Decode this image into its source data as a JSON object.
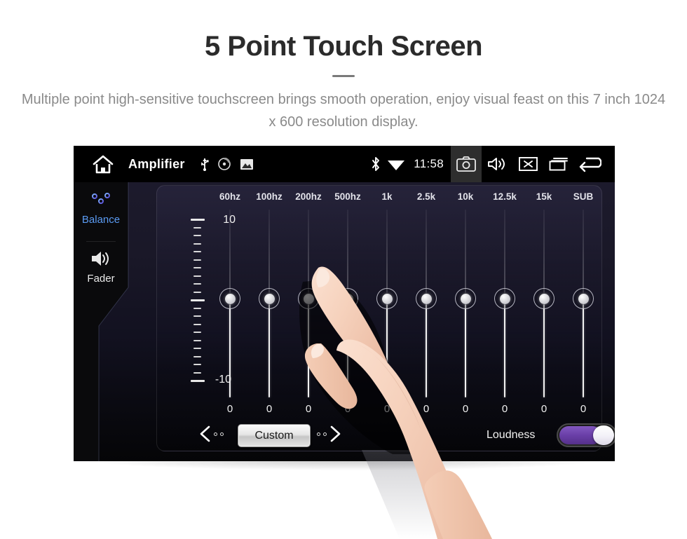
{
  "promo": {
    "title": "5 Point Touch Screen",
    "subtitle": "Multiple point high-sensitive touchscreen brings smooth operation, enjoy visual feast on this 7 inch 1024 x 600 resolution display."
  },
  "statusbar": {
    "home_icon": "home-icon",
    "title": "Amplifier",
    "left_icons": [
      "usb-icon",
      "disc-icon",
      "picture-icon"
    ],
    "right_icons": [
      "bluetooth-icon",
      "wifi-icon"
    ],
    "clock": "11:58",
    "buttons": [
      "camera-icon",
      "volume-icon",
      "close-icon",
      "recents-icon",
      "back-icon"
    ],
    "active_button": "camera-icon"
  },
  "rail": {
    "items": [
      {
        "label": "Balance",
        "icon": "equalizer-sliders-icon",
        "active": true
      },
      {
        "label": "Fader",
        "icon": "speaker-icon",
        "active": false
      }
    ]
  },
  "equalizer": {
    "bands": [
      {
        "freq": "60hz",
        "value": "0"
      },
      {
        "freq": "100hz",
        "value": "0"
      },
      {
        "freq": "200hz",
        "value": "0"
      },
      {
        "freq": "500hz",
        "value": "0"
      },
      {
        "freq": "1k",
        "value": "0"
      },
      {
        "freq": "2.5k",
        "value": "0"
      },
      {
        "freq": "10k",
        "value": "0"
      },
      {
        "freq": "12.5k",
        "value": "0"
      },
      {
        "freq": "15k",
        "value": "0"
      },
      {
        "freq": "SUB",
        "value": "0"
      }
    ],
    "scale": {
      "max": "10",
      "mid": "0",
      "min": "-10"
    }
  },
  "bottom": {
    "prev_icon": "chevron-left-icon",
    "next_icon": "chevron-right-icon",
    "preset": "Custom",
    "loudness_label": "Loudness",
    "loudness_on": true
  },
  "colors": {
    "accent_blue": "#5b9bf3",
    "toggle_purple": "#6a3fa8",
    "screen_black": "#050505",
    "panel_top": "#1c1a2c"
  }
}
